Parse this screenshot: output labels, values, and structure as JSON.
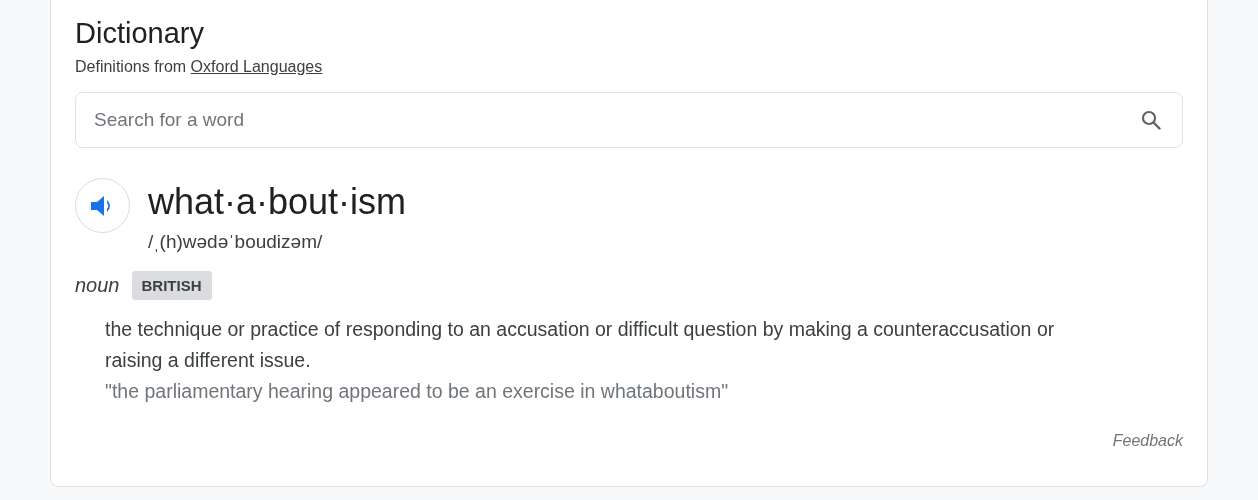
{
  "header": {
    "title": "Dictionary",
    "subtitle": "Definitions from ",
    "source_link": "Oxford Languages"
  },
  "search": {
    "placeholder": "Search for a word"
  },
  "entry": {
    "word": "what·a·bout·ism",
    "pronunciation": "/ˌ(h)wədəˈboudizəm/",
    "part_of_speech": "noun",
    "label": "BRITISH",
    "definition": "the technique or practice of responding to an accusation or difficult question by making a counteraccusation or raising a different issue.",
    "example": "\"the parliamentary hearing appeared to be an exercise in whataboutism\""
  },
  "feedback": "Feedback"
}
